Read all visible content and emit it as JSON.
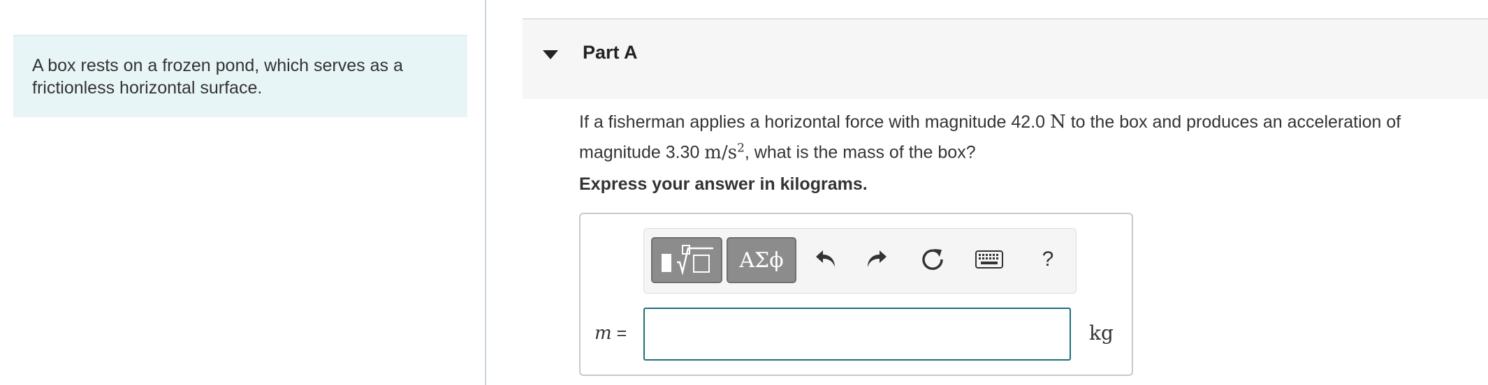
{
  "intro": {
    "text": "A box rests on a frozen pond, which serves as a frictionless horizontal surface."
  },
  "part": {
    "title": "Part A",
    "expanded": true
  },
  "question": {
    "text_1": "If a fisherman applies a horizontal force with magnitude 42.0 ",
    "force_unit": "N",
    "text_2": " to the box and produces an acceleration of magnitude 3.30 ",
    "accel_unit": "m/s",
    "accel_exp": "2",
    "text_3": ", what is the mass of the box?"
  },
  "instruction": "Express your answer in kilograms.",
  "toolbar": {
    "symbols_label": "ΑΣϕ",
    "help_label": "?",
    "icons": [
      "templates-icon",
      "greek-symbols",
      "undo-icon",
      "redo-icon",
      "reset-icon",
      "keyboard-icon",
      "help-icon"
    ]
  },
  "answer": {
    "variable": "m",
    "equals": " =",
    "value": "",
    "unit": "kg"
  },
  "colors": {
    "intro_bg": "#e8f5f6",
    "header_bg": "#f6f6f6",
    "input_border": "#1d6f7b",
    "tool_button": "#8c8c8c"
  }
}
